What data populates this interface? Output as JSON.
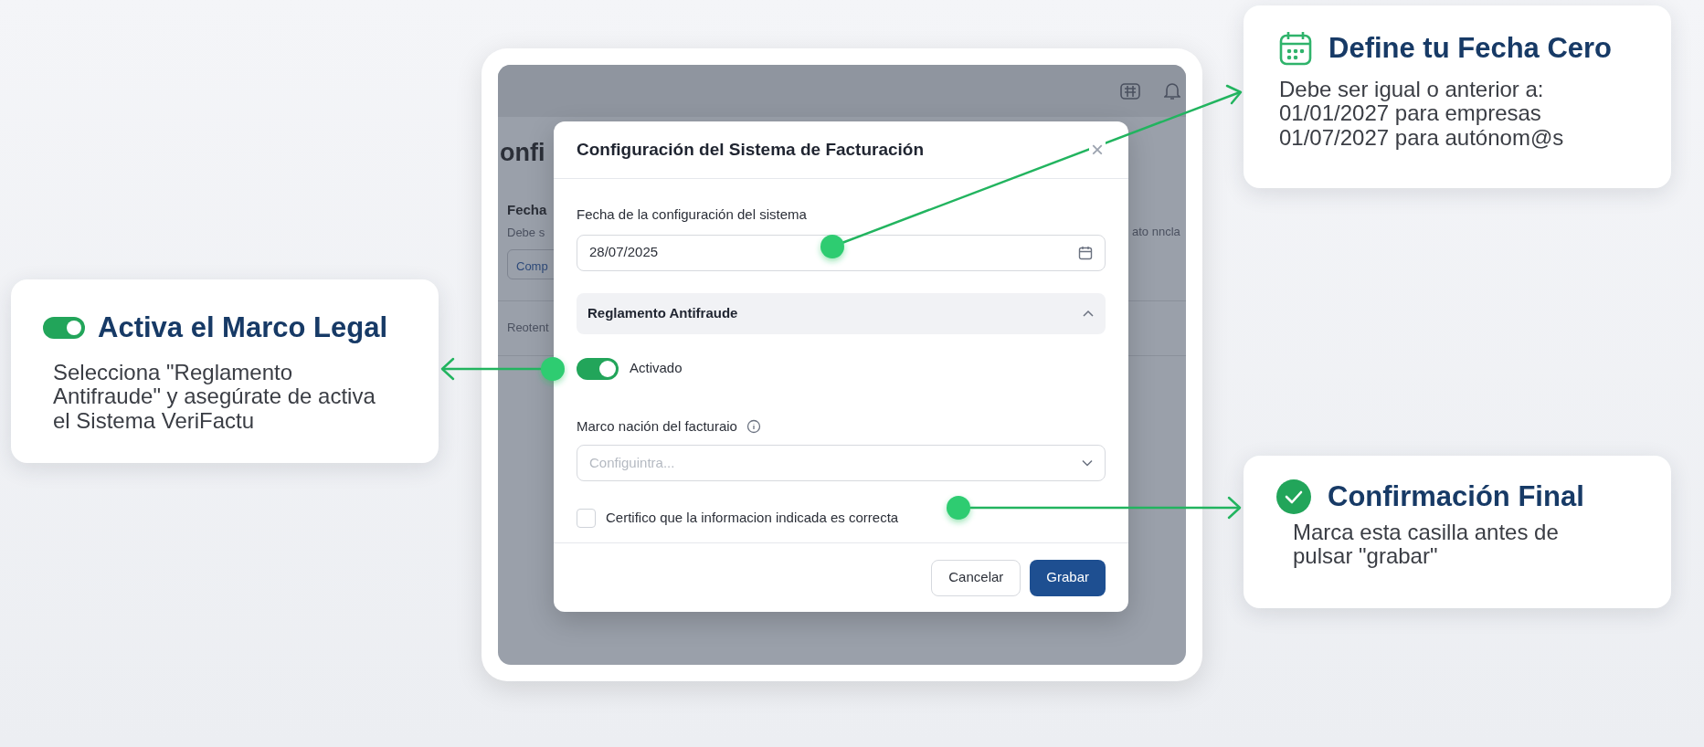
{
  "background_app": {
    "page_title": "onfi",
    "section_label": "Fecha",
    "section_hint": "Debe s",
    "section_button": "Comp",
    "row_label": "Reotent",
    "side_text": "ato nncla"
  },
  "dialog": {
    "title": "Configuración del Sistema de Facturación",
    "close": "×",
    "date_label": "Fecha de la configuración del sistema",
    "date_value": "28/07/2025",
    "section": {
      "label": "Reglamento Antifraude",
      "expanded": true
    },
    "toggle": {
      "label": "Activado",
      "on": true
    },
    "select_label": "Marco nación del facturaio",
    "select": {
      "placeholder": "Configuintra..."
    },
    "certify": {
      "label": "Certifico que la informacion indicada es correcta",
      "checked": false
    },
    "buttons": [
      {
        "label": "Cancelar",
        "kind": "secondary"
      },
      {
        "label": "Grabar",
        "kind": "primary"
      }
    ]
  },
  "callouts": [
    {
      "kind": "calendar",
      "title": "Define tu Fecha Cero",
      "lines": [
        "Debe ser igual o anterior a:",
        "01/01/2027 para empresas",
        "01/07/2027 para autónom@s"
      ]
    },
    {
      "kind": "toggle",
      "title": "Activa el Marco Legal",
      "lines": [
        "Selecciona \"Reglamento Antifraude\" y asegúrate de activa el Sistema VeriFactu"
      ]
    },
    {
      "kind": "check",
      "title": "Confirmación Final",
      "lines": [
        "Marca esta casilla antes de pulsar \"grabar\""
      ]
    }
  ]
}
